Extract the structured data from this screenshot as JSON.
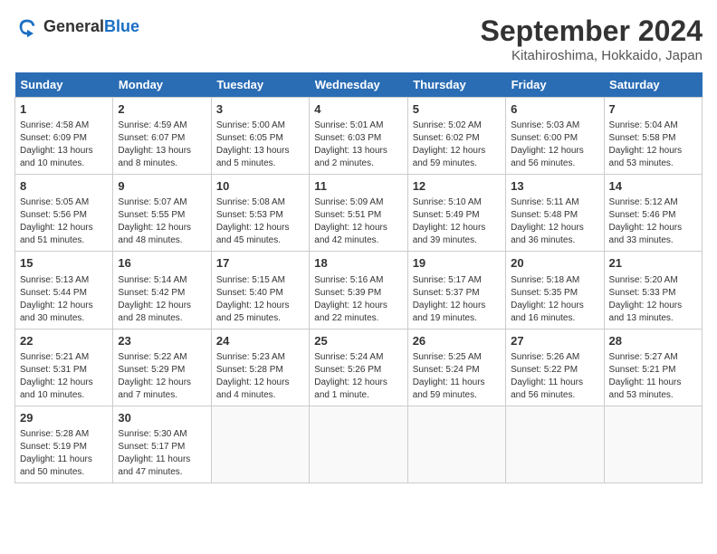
{
  "header": {
    "logo_line1": "General",
    "logo_line2": "Blue",
    "month_title": "September 2024",
    "subtitle": "Kitahiroshima, Hokkaido, Japan"
  },
  "days_of_week": [
    "Sunday",
    "Monday",
    "Tuesday",
    "Wednesday",
    "Thursday",
    "Friday",
    "Saturday"
  ],
  "weeks": [
    [
      {
        "day": 1,
        "info": "Sunrise: 4:58 AM\nSunset: 6:09 PM\nDaylight: 13 hours and 10 minutes."
      },
      {
        "day": 2,
        "info": "Sunrise: 4:59 AM\nSunset: 6:07 PM\nDaylight: 13 hours and 8 minutes."
      },
      {
        "day": 3,
        "info": "Sunrise: 5:00 AM\nSunset: 6:05 PM\nDaylight: 13 hours and 5 minutes."
      },
      {
        "day": 4,
        "info": "Sunrise: 5:01 AM\nSunset: 6:03 PM\nDaylight: 13 hours and 2 minutes."
      },
      {
        "day": 5,
        "info": "Sunrise: 5:02 AM\nSunset: 6:02 PM\nDaylight: 12 hours and 59 minutes."
      },
      {
        "day": 6,
        "info": "Sunrise: 5:03 AM\nSunset: 6:00 PM\nDaylight: 12 hours and 56 minutes."
      },
      {
        "day": 7,
        "info": "Sunrise: 5:04 AM\nSunset: 5:58 PM\nDaylight: 12 hours and 53 minutes."
      }
    ],
    [
      {
        "day": 8,
        "info": "Sunrise: 5:05 AM\nSunset: 5:56 PM\nDaylight: 12 hours and 51 minutes."
      },
      {
        "day": 9,
        "info": "Sunrise: 5:07 AM\nSunset: 5:55 PM\nDaylight: 12 hours and 48 minutes."
      },
      {
        "day": 10,
        "info": "Sunrise: 5:08 AM\nSunset: 5:53 PM\nDaylight: 12 hours and 45 minutes."
      },
      {
        "day": 11,
        "info": "Sunrise: 5:09 AM\nSunset: 5:51 PM\nDaylight: 12 hours and 42 minutes."
      },
      {
        "day": 12,
        "info": "Sunrise: 5:10 AM\nSunset: 5:49 PM\nDaylight: 12 hours and 39 minutes."
      },
      {
        "day": 13,
        "info": "Sunrise: 5:11 AM\nSunset: 5:48 PM\nDaylight: 12 hours and 36 minutes."
      },
      {
        "day": 14,
        "info": "Sunrise: 5:12 AM\nSunset: 5:46 PM\nDaylight: 12 hours and 33 minutes."
      }
    ],
    [
      {
        "day": 15,
        "info": "Sunrise: 5:13 AM\nSunset: 5:44 PM\nDaylight: 12 hours and 30 minutes."
      },
      {
        "day": 16,
        "info": "Sunrise: 5:14 AM\nSunset: 5:42 PM\nDaylight: 12 hours and 28 minutes."
      },
      {
        "day": 17,
        "info": "Sunrise: 5:15 AM\nSunset: 5:40 PM\nDaylight: 12 hours and 25 minutes."
      },
      {
        "day": 18,
        "info": "Sunrise: 5:16 AM\nSunset: 5:39 PM\nDaylight: 12 hours and 22 minutes."
      },
      {
        "day": 19,
        "info": "Sunrise: 5:17 AM\nSunset: 5:37 PM\nDaylight: 12 hours and 19 minutes."
      },
      {
        "day": 20,
        "info": "Sunrise: 5:18 AM\nSunset: 5:35 PM\nDaylight: 12 hours and 16 minutes."
      },
      {
        "day": 21,
        "info": "Sunrise: 5:20 AM\nSunset: 5:33 PM\nDaylight: 12 hours and 13 minutes."
      }
    ],
    [
      {
        "day": 22,
        "info": "Sunrise: 5:21 AM\nSunset: 5:31 PM\nDaylight: 12 hours and 10 minutes."
      },
      {
        "day": 23,
        "info": "Sunrise: 5:22 AM\nSunset: 5:29 PM\nDaylight: 12 hours and 7 minutes."
      },
      {
        "day": 24,
        "info": "Sunrise: 5:23 AM\nSunset: 5:28 PM\nDaylight: 12 hours and 4 minutes."
      },
      {
        "day": 25,
        "info": "Sunrise: 5:24 AM\nSunset: 5:26 PM\nDaylight: 12 hours and 1 minute."
      },
      {
        "day": 26,
        "info": "Sunrise: 5:25 AM\nSunset: 5:24 PM\nDaylight: 11 hours and 59 minutes."
      },
      {
        "day": 27,
        "info": "Sunrise: 5:26 AM\nSunset: 5:22 PM\nDaylight: 11 hours and 56 minutes."
      },
      {
        "day": 28,
        "info": "Sunrise: 5:27 AM\nSunset: 5:21 PM\nDaylight: 11 hours and 53 minutes."
      }
    ],
    [
      {
        "day": 29,
        "info": "Sunrise: 5:28 AM\nSunset: 5:19 PM\nDaylight: 11 hours and 50 minutes."
      },
      {
        "day": 30,
        "info": "Sunrise: 5:30 AM\nSunset: 5:17 PM\nDaylight: 11 hours and 47 minutes."
      },
      null,
      null,
      null,
      null,
      null
    ]
  ]
}
